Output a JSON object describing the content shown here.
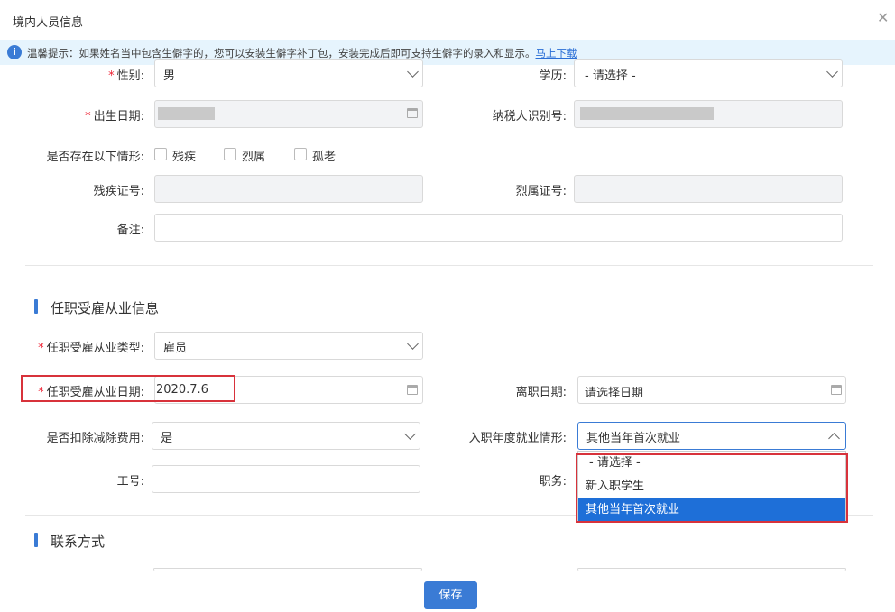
{
  "dialog": {
    "title": "境内人员信息"
  },
  "tip": {
    "text": "温馨提示：如果姓名当中包含生僻字的，您可以安装生僻字补丁包，安装完成后即可支持生僻字的录入和显示。",
    "link": "马上下载",
    "icon": "info-icon"
  },
  "basic": {
    "gender_label": "性别:",
    "gender_value": "男",
    "education_label": "学历:",
    "education_value": "- 请选择 -",
    "birth_label": "出生日期:",
    "taxid_label": "纳税人识别号:",
    "situation_label": "是否存在以下情形:",
    "options": [
      "残疾",
      "烈属",
      "孤老"
    ],
    "disability_no_label": "残疾证号:",
    "martyr_no_label": "烈属证号:",
    "remark_label": "备注:"
  },
  "employment": {
    "section_title": "任职受雇从业信息",
    "type_label": "任职受雇从业类型:",
    "type_value": "雇员",
    "date_label": "任职受雇从业日期:",
    "date_value": "2020.7.6",
    "leave_label": "离职日期:",
    "leave_placeholder": "请选择日期",
    "deduct_label": "是否扣除减除费用:",
    "deduct_value": "是",
    "situation_label": "入职年度就业情形:",
    "situation_value": "其他当年首次就业",
    "dropdown_options": [
      "- 请选择 -",
      "新入职学生",
      "其他当年首次就业"
    ],
    "dropdown_selected": 2,
    "jobno_label": "工号:",
    "position_label": "职务:"
  },
  "contact": {
    "section_title": "联系方式"
  },
  "footer": {
    "save_label": "保存"
  },
  "colors": {
    "accent": "#3a7bd5",
    "highlight": "#d8323b",
    "required": "#e23"
  }
}
